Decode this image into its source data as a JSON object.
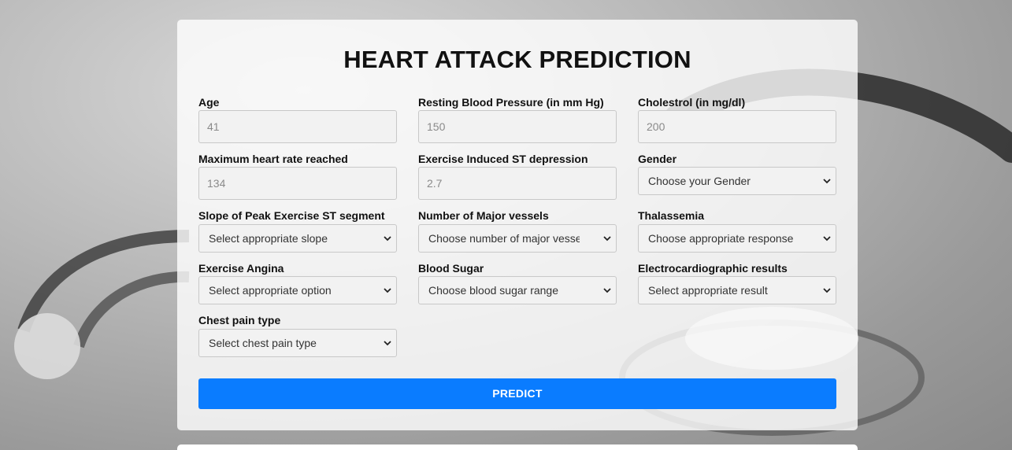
{
  "page_title": "HEART ATTACK PREDICTION",
  "fields": {
    "age": {
      "label": "Age",
      "placeholder": "41"
    },
    "resting_bp": {
      "label": "Resting Blood Pressure (in mm Hg)",
      "placeholder": "150"
    },
    "cholestrol": {
      "label": "Cholestrol (in mg/dl)",
      "placeholder": "200"
    },
    "max_heart_rate": {
      "label": "Maximum heart rate reached",
      "placeholder": "134"
    },
    "st_depression": {
      "label": "Exercise Induced ST depression",
      "placeholder": "2.7"
    },
    "gender": {
      "label": "Gender",
      "selected": "Choose your Gender"
    },
    "slope": {
      "label": "Slope of Peak Exercise ST segment",
      "selected": "Select appropriate slope"
    },
    "major_vessels": {
      "label": "Number of Major vessels",
      "selected": "Choose number of major vessels"
    },
    "thalassemia": {
      "label": "Thalassemia",
      "selected": "Choose appropriate response"
    },
    "exercise_angina": {
      "label": "Exercise Angina",
      "selected": "Select appropriate option"
    },
    "blood_sugar": {
      "label": "Blood Sugar",
      "selected": "Choose blood sugar range"
    },
    "ecg_results": {
      "label": "Electrocardiographic results",
      "selected": "Select appropriate result"
    },
    "chest_pain": {
      "label": "Chest pain type",
      "selected": "Select chest pain type"
    }
  },
  "predict_button": "PREDICT",
  "icons": {
    "dropdown": "chevron-down-icon"
  },
  "colors": {
    "accent": "#0a7cff",
    "background": "#a8a8a8"
  }
}
